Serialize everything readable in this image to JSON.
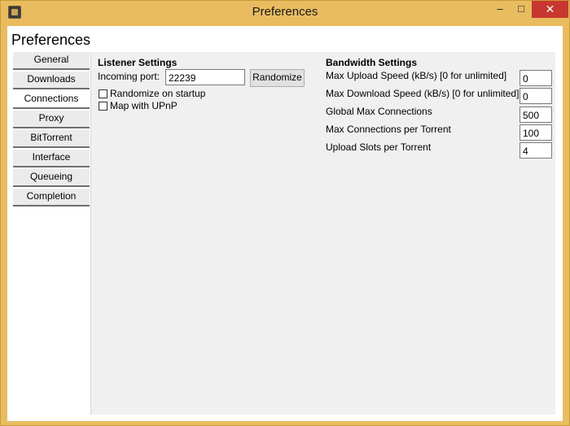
{
  "window": {
    "title": "Preferences"
  },
  "heading": "Preferences",
  "tabs": [
    {
      "label": "General"
    },
    {
      "label": "Downloads"
    },
    {
      "label": "Connections"
    },
    {
      "label": "Proxy"
    },
    {
      "label": "BitTorrent"
    },
    {
      "label": "Interface"
    },
    {
      "label": "Queueing"
    },
    {
      "label": "Completion"
    }
  ],
  "active_tab": "Connections",
  "listener": {
    "title": "Listener Settings",
    "incoming_port_label": "Incoming port:",
    "incoming_port_value": "22239",
    "randomize_button": "Randomize",
    "randomize_on_startup_label": "Randomize on startup",
    "randomize_on_startup_checked": false,
    "map_upnp_label": "Map with UPnP",
    "map_upnp_checked": false
  },
  "bandwidth": {
    "title": "Bandwidth Settings",
    "max_upload_label": "Max Upload Speed (kB/s) [0 for unlimited]",
    "max_upload_value": "0",
    "max_download_label": "Max Download Speed (kB/s) [0 for unlimited]",
    "max_download_value": "0",
    "global_max_conn_label": "Global Max Connections",
    "global_max_conn_value": "500",
    "max_conn_per_torrent_label": "Max Connections per Torrent",
    "max_conn_per_torrent_value": "100",
    "upload_slots_label": "Upload Slots per Torrent",
    "upload_slots_value": "4"
  }
}
